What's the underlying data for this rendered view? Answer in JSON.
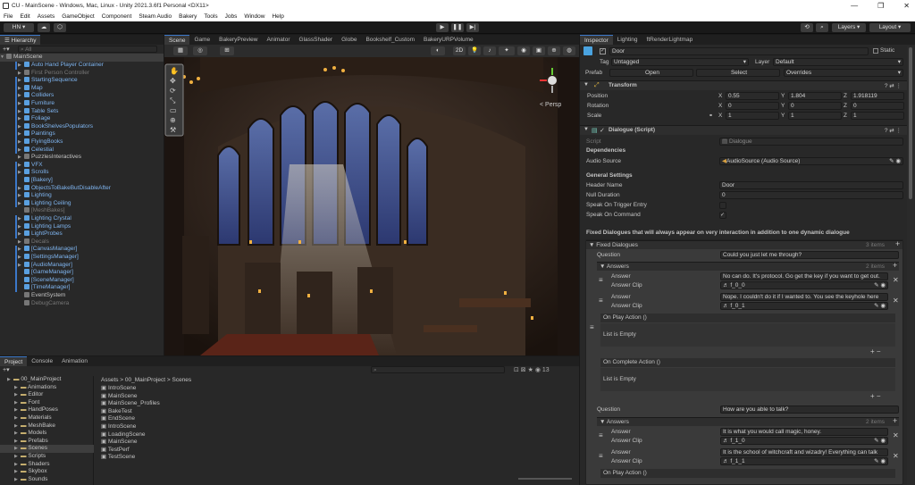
{
  "window": {
    "title": "CU - MainScene - Windows, Mac, Linux - Unity 2021.3.6f1 Personal <DX11>",
    "min": "—",
    "max": "❐",
    "close": "✕"
  },
  "menu": [
    "File",
    "Edit",
    "Assets",
    "GameObject",
    "Component",
    "Steam Audio",
    "Bakery",
    "Tools",
    "Jobs",
    "Window",
    "Help"
  ],
  "toolbar": {
    "account": "HN ▾",
    "layers": "Layers",
    "layout": "Layout"
  },
  "hierarchy": {
    "tab": "Hierarchy",
    "search_placeholder": "All",
    "root": "MainScene",
    "items": [
      {
        "label": "Auto Hand Player Container",
        "style": "blue",
        "arrow": "▶",
        "icon": "blue",
        "bar": true
      },
      {
        "label": "First Person Controller",
        "style": "dim",
        "arrow": "▶",
        "icon": "grey",
        "bar": false
      },
      {
        "label": "StartingSequence",
        "style": "blue",
        "arrow": "▶",
        "icon": "blue",
        "bar": true
      },
      {
        "label": "Map",
        "style": "blue",
        "arrow": "▶",
        "icon": "blue",
        "bar": true
      },
      {
        "label": "Colliders",
        "style": "blue",
        "arrow": "▶",
        "icon": "blue",
        "bar": true
      },
      {
        "label": "Furniture",
        "style": "blue",
        "arrow": "▶",
        "icon": "blue",
        "bar": true
      },
      {
        "label": "Table Sets",
        "style": "blue",
        "arrow": "▶",
        "icon": "blue",
        "bar": true
      },
      {
        "label": "Foliage",
        "style": "blue",
        "arrow": "▶",
        "icon": "blue",
        "bar": true
      },
      {
        "label": "BookShelvesPopulators",
        "style": "blue",
        "arrow": "▶",
        "icon": "blue",
        "bar": true
      },
      {
        "label": "Paintings",
        "style": "blue",
        "arrow": "▶",
        "icon": "blue",
        "bar": true
      },
      {
        "label": "FlyingBooks",
        "style": "blue",
        "arrow": "▶",
        "icon": "blue",
        "bar": true
      },
      {
        "label": "Celestial",
        "style": "blue",
        "arrow": "▶",
        "icon": "blue",
        "bar": true
      },
      {
        "label": "PuzzlesInteractives",
        "style": "",
        "arrow": "▶",
        "icon": "grey",
        "bar": false
      },
      {
        "label": "VFX",
        "style": "blue",
        "arrow": "▶",
        "icon": "blue",
        "bar": true
      },
      {
        "label": "Scrolls",
        "style": "blue",
        "arrow": "▶",
        "icon": "blue",
        "bar": true
      },
      {
        "label": "[Bakery]",
        "style": "blue",
        "arrow": "",
        "icon": "blue",
        "bar": true
      },
      {
        "label": "ObjectsToBakeButDisableAfter",
        "style": "blue",
        "arrow": "▶",
        "icon": "blue",
        "bar": true
      },
      {
        "label": "Lighting",
        "style": "blue",
        "arrow": "▶",
        "icon": "blue",
        "bar": true
      },
      {
        "label": "Lighting Ceiling",
        "style": "blue",
        "arrow": "▶",
        "icon": "blue",
        "bar": true
      },
      {
        "label": "[MeshBakes]",
        "style": "dim",
        "arrow": "",
        "icon": "grey",
        "bar": false
      },
      {
        "label": "Lighting Crystal",
        "style": "blue",
        "arrow": "▶",
        "icon": "blue",
        "bar": true
      },
      {
        "label": "Lighting Lamps",
        "style": "blue",
        "arrow": "▶",
        "icon": "blue",
        "bar": true
      },
      {
        "label": "LightProbes",
        "style": "blue",
        "arrow": "▶",
        "icon": "blue",
        "bar": true
      },
      {
        "label": "Decals",
        "style": "dim",
        "arrow": "▶",
        "icon": "grey",
        "bar": false
      },
      {
        "label": "[CanvasManager]",
        "style": "blue",
        "arrow": "▶",
        "icon": "blue",
        "bar": true
      },
      {
        "label": "[SettingsManager]",
        "style": "blue",
        "arrow": "▶",
        "icon": "blue",
        "bar": true
      },
      {
        "label": "[AudioManager]",
        "style": "blue",
        "arrow": "▶",
        "icon": "blue",
        "bar": true
      },
      {
        "label": "[GameManager]",
        "style": "blue",
        "arrow": "",
        "icon": "blue",
        "bar": true
      },
      {
        "label": "[SceneManager]",
        "style": "blue",
        "arrow": "",
        "icon": "blue",
        "bar": true
      },
      {
        "label": "[TimeManager]",
        "style": "blue",
        "arrow": "",
        "icon": "blue",
        "bar": true
      },
      {
        "label": "EventSystem",
        "style": "",
        "arrow": "",
        "icon": "grey",
        "bar": false
      },
      {
        "label": "DebugCamera",
        "style": "dim",
        "arrow": "",
        "icon": "grey",
        "bar": false
      }
    ]
  },
  "scene_tabs": [
    "Scene",
    "Game",
    "BakeryPreview",
    "Animator",
    "GlassShader",
    "Globe",
    "Bookshelf_Custom",
    "BakeryURPVolume"
  ],
  "scene": {
    "persp": "< Persp",
    "mode_2d": "2D"
  },
  "project": {
    "tabs": [
      "Project",
      "Console",
      "Animation"
    ],
    "tree": [
      {
        "label": "00_MainProject",
        "indent": 1,
        "sel": false
      },
      {
        "label": "Animations",
        "indent": 2,
        "sel": false
      },
      {
        "label": "Editor",
        "indent": 2,
        "sel": false
      },
      {
        "label": "Font",
        "indent": 2,
        "sel": false
      },
      {
        "label": "HandPoses",
        "indent": 2,
        "sel": false
      },
      {
        "label": "Materials",
        "indent": 2,
        "sel": false
      },
      {
        "label": "MeshBake",
        "indent": 2,
        "sel": false
      },
      {
        "label": "Models",
        "indent": 2,
        "sel": false
      },
      {
        "label": "Prefabs",
        "indent": 2,
        "sel": false
      },
      {
        "label": "Scenes",
        "indent": 2,
        "sel": true
      },
      {
        "label": "Scripts",
        "indent": 2,
        "sel": false
      },
      {
        "label": "Shaders",
        "indent": 2,
        "sel": false
      },
      {
        "label": "Skybox",
        "indent": 2,
        "sel": false
      },
      {
        "label": "Sounds",
        "indent": 2,
        "sel": false
      }
    ],
    "breadcrumb": "Assets > 00_MainProject > Scenes",
    "files": [
      "IntroScene",
      "MainScene",
      "MainScene_Profiles",
      "BakeTest",
      "EndScene",
      "IntroScene",
      "LoadingScene",
      "MainScene",
      "TestPerf",
      "TestScene"
    ],
    "count": "13"
  },
  "inspector": {
    "tabs": [
      "Inspector",
      "Lighting",
      "ftRenderLightmap"
    ],
    "name": "Door",
    "static": "Static",
    "tag_label": "Tag",
    "tag": "Untagged",
    "layer_label": "Layer",
    "layer": "Default",
    "prefab_label": "Prefab",
    "open": "Open",
    "select": "Select",
    "overrides": "Overrides",
    "transform": {
      "title": "Transform",
      "rows": [
        {
          "label": "Position",
          "x": "0.55",
          "y": "1.804",
          "z": "1.918119"
        },
        {
          "label": "Rotation",
          "x": "0",
          "y": "0",
          "z": "0"
        },
        {
          "label": "Scale",
          "x": "1",
          "y": "1",
          "z": "1"
        }
      ]
    },
    "dialogue": {
      "title": "Dialogue (Script)",
      "script_label": "Script",
      "script_value": "Dialogue",
      "dependencies": "Dependencies",
      "audio_label": "Audio Source",
      "audio_value": "AudioSource (Audio Source)",
      "general": "General Settings",
      "header_label": "Header Name",
      "header_value": "Door",
      "null_label": "Null Duration",
      "null_value": "0",
      "trigger_label": "Speak On Trigger Entry",
      "command_label": "Speak On Command",
      "fixed_title": "Fixed Dialogues that will always appear on very interaction in addition to one dynamic dialogue",
      "fixed_label": "Fixed Dialogues",
      "fixed_count": "3 items",
      "question_label": "Question",
      "q1": "Could you just let me through?",
      "answers_label": "Answers",
      "answers_count": "2 items",
      "answer_label": "Answer",
      "clip_label": "Answer Clip",
      "a1": "No can do. It's protocol. Go get the key if you want to get out.",
      "a1_clip": "f_0_0",
      "a2": "Nope. I couldn't do it if I wanted to. You see the keyhole here",
      "a2_clip": "f_0_1",
      "on_play": "On Play Action ()",
      "list_empty": "List is Empty",
      "on_complete": "On Complete Action ()",
      "q2": "How are you able to talk?",
      "a3": "It is what you would call magic, honey.",
      "a3_clip": "f_1_0",
      "a4": "It is the school of witchcraft and wizadry! Everything can talk",
      "a4_clip": "f_1_1"
    }
  }
}
